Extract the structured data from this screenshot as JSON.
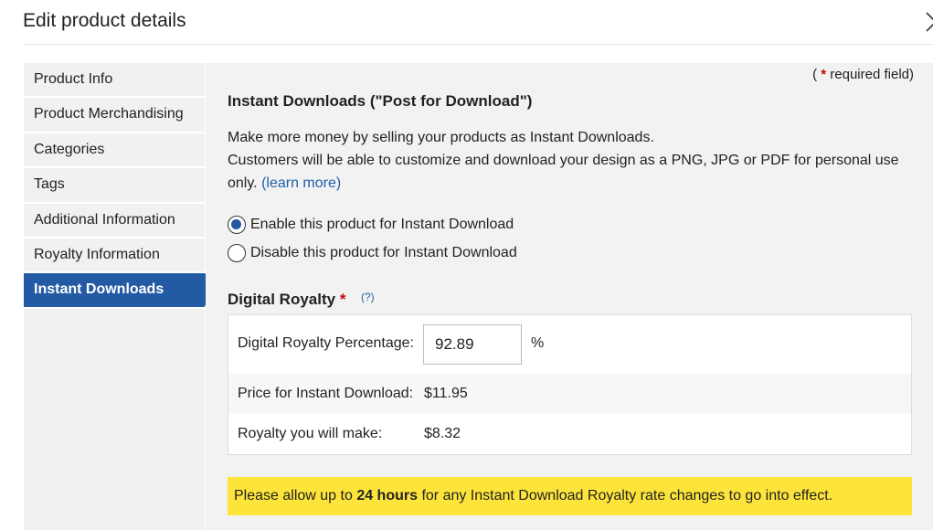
{
  "dialog": {
    "title": "Edit product details"
  },
  "sidebar": {
    "items": [
      {
        "label": "Product Info"
      },
      {
        "label": "Product Merchandising"
      },
      {
        "label": "Categories"
      },
      {
        "label": "Tags"
      },
      {
        "label": "Additional Information"
      },
      {
        "label": "Royalty Information"
      },
      {
        "label": "Instant Downloads"
      }
    ],
    "active": "Instant Downloads"
  },
  "main": {
    "required_note_open": "(",
    "required_star": "*",
    "required_note_text": "required field)",
    "section_title": "Instant Downloads (\"Post for Download\")",
    "description_line1": "Make more money by selling your products as Instant Downloads.",
    "description_line2": "Customers will be able to customize and download your design as a PNG, JPG or PDF for personal use only.",
    "learn_more": "(learn more)",
    "radio_enable": "Enable this product for Instant Download",
    "radio_disable": "Disable this product for Instant Download",
    "radio_selected": "enable",
    "royalty_title": "Digital Royalty",
    "royalty_star": "*",
    "help_link": "(?)",
    "royalty": {
      "percentage_label": "Digital Royalty Percentage:",
      "percentage_value": "92.89",
      "percent_sign": "%",
      "price_label": "Price for Instant Download:",
      "price_value": "$11.95",
      "royalty_label": "Royalty you will make:",
      "royalty_value": "$8.32"
    },
    "notice": {
      "prefix": "Please allow up to ",
      "bold": "24 hours",
      "suffix": " for any Instant Download Royalty rate changes to go into effect."
    }
  },
  "colors": {
    "active_nav": "#245aa4",
    "link": "#2160a8",
    "required_star": "#cc0000",
    "notice_bg": "#fde43a"
  },
  "icons": {
    "close": "close-icon"
  }
}
